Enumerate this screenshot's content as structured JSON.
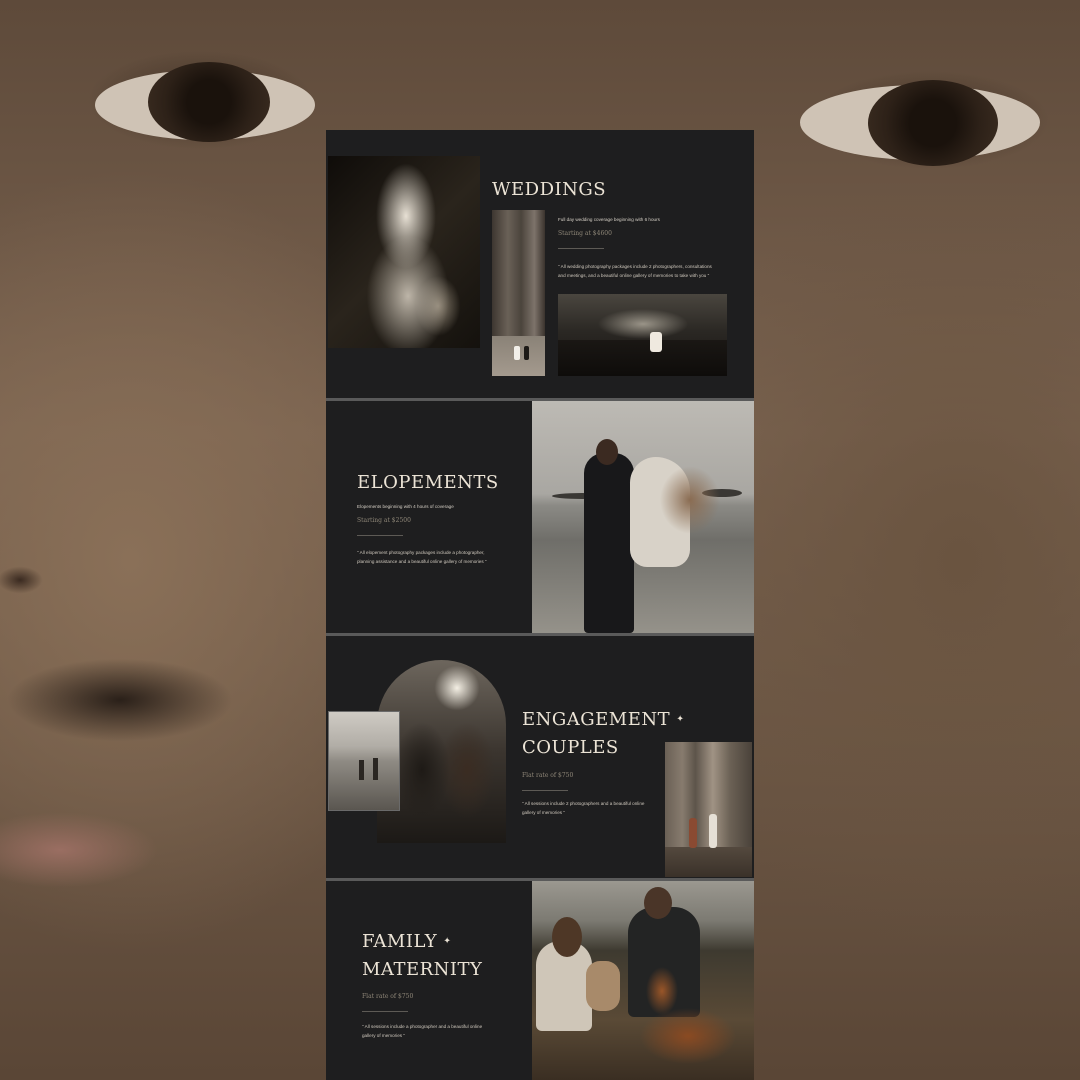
{
  "weddings": {
    "title": "WEDDINGS",
    "coverage": "Full day wedding coverage beginning with 6 hours",
    "price": "Starting at $4600",
    "quote": "\" All wedding photography packages include 2 photographers, consultations and meetings, and a beautiful online gallery of memories to take with you \""
  },
  "elopements": {
    "title": "ELOPEMENTS",
    "coverage": "Elopements beginning with 4 hours of coverage",
    "price": "Starting at $2500",
    "quote": "\" All elopement photography packages include a photographer, planning assistance and a beautiful online gallery of memories \""
  },
  "engagement": {
    "title_line1": "ENGAGEMENT",
    "title_line2": "COUPLES",
    "diamond": "✦",
    "price": "Flat rate of $750",
    "quote": "\" All sessions include 2 photographers and a beautiful online gallery of memories \""
  },
  "family": {
    "title_line1": "FAMILY",
    "title_line2": "MATERNITY",
    "diamond": "✦",
    "price": "Flat rate of $750",
    "quote": "\" All sessions include a photographer and a beautiful online gallery of memories \""
  }
}
